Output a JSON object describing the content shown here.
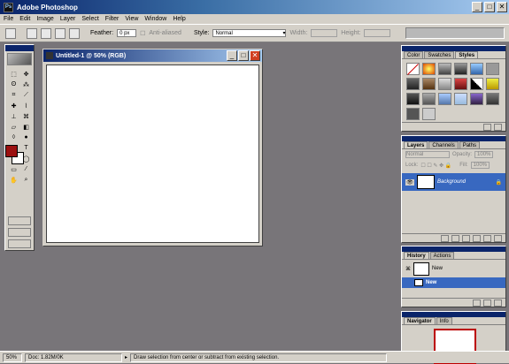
{
  "app": {
    "title": "Adobe Photoshop",
    "icon": "photoshop-icon"
  },
  "window_buttons": {
    "min": "_",
    "max": "□",
    "close": "✕"
  },
  "menu": [
    "File",
    "Edit",
    "Image",
    "Layer",
    "Select",
    "Filter",
    "View",
    "Window",
    "Help"
  ],
  "options": {
    "feather_label": "Feather:",
    "feather_value": "0 px",
    "antialiased_label": "Anti-aliased",
    "style_label": "Style:",
    "style_value": "Normal",
    "width_label": "Width:",
    "height_label": "Height:"
  },
  "document": {
    "title": "Untitled-1 @ 50% (RGB)"
  },
  "colors": {
    "foreground": "#9b1010",
    "background": "#ffffff"
  },
  "styles_panel": {
    "tabs": [
      "Color",
      "Swatches",
      "Styles"
    ],
    "active": "Styles"
  },
  "layers_panel": {
    "tabs": [
      "Layers",
      "Channels",
      "Paths"
    ],
    "blend_mode": "Normal",
    "opacity_label": "Opacity:",
    "opacity_value": "100%",
    "lock_label": "Lock:",
    "fill_label": "Fill:",
    "fill_value": "100%",
    "layer_name": "Background"
  },
  "history_panel": {
    "tabs": [
      "History",
      "Actions"
    ],
    "snapshot_label": "New",
    "state_label": "New"
  },
  "navigator_panel": {
    "tabs": [
      "Navigator",
      "Info"
    ]
  },
  "status": {
    "zoom": "50%",
    "doc": "Doc: 1.82M/0K",
    "hint": "Draw selection from center or subtract from existing selection."
  }
}
